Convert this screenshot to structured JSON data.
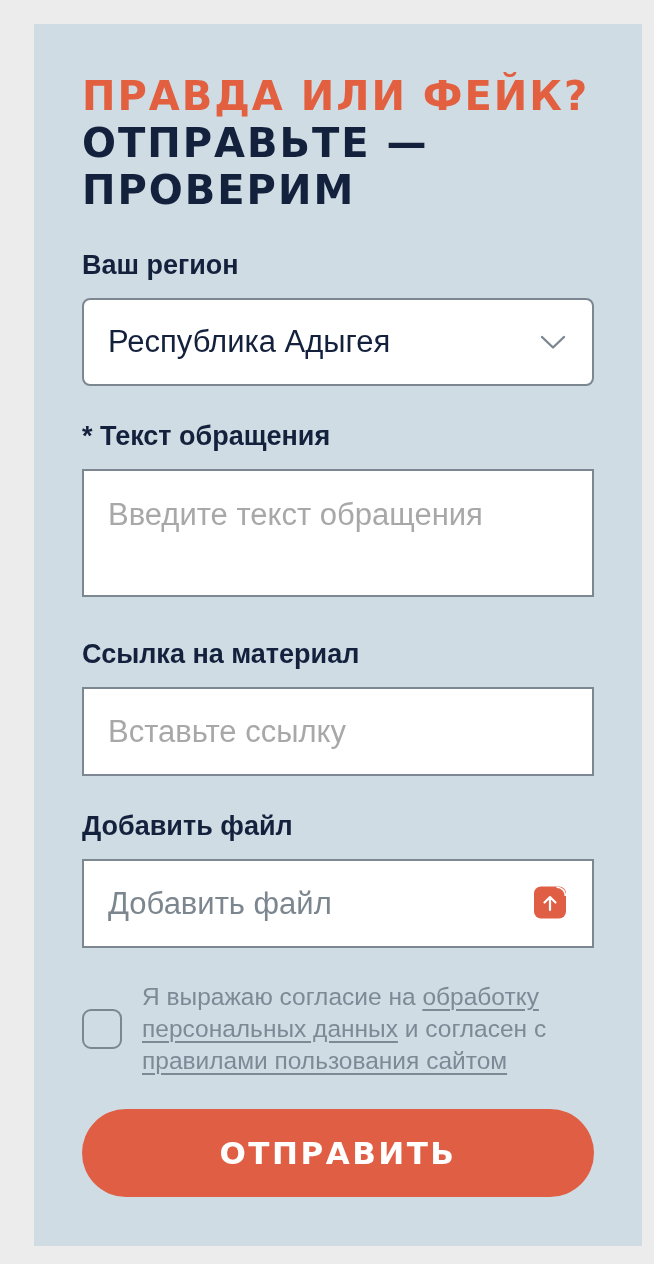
{
  "heading": {
    "accent": "ПРАВДА ИЛИ ФЕЙК?",
    "text": "ОТПРАВЬТЕ — ПРОВЕРИМ"
  },
  "fields": [
    {
      "kind": "select",
      "label": "Ваш регион",
      "value": "Республика Адыгея"
    },
    {
      "kind": "textarea",
      "label": "* Текст обращения",
      "placeholder": "Введите текст обращения"
    },
    {
      "kind": "text",
      "label": "Ссылка на материал",
      "placeholder": "Вставьте ссылку"
    },
    {
      "kind": "file",
      "label": "Добавить файл",
      "placeholder": "Добавить файл"
    }
  ],
  "consent": {
    "checked": false,
    "parts": [
      {
        "kind": "text",
        "text": "Я выражаю согласие на"
      },
      {
        "kind": "link",
        "text": "обработку"
      },
      {
        "kind": "link",
        "text": "персональных данных"
      },
      {
        "kind": "text",
        "text": "и согласен с"
      },
      {
        "kind": "link",
        "text": "правилами пользования сайтом"
      }
    ]
  },
  "submit_button": "ОТПРАВИТЬ"
}
